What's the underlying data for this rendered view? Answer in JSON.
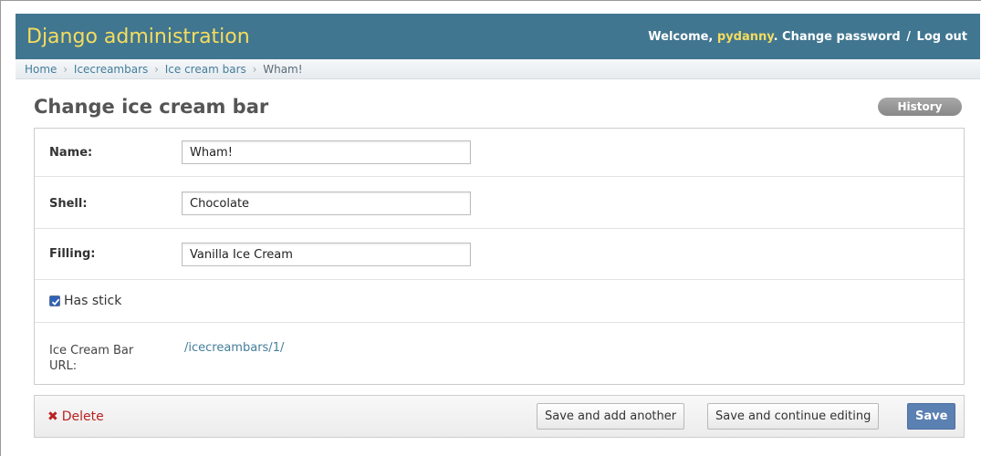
{
  "header": {
    "brand": "Django administration",
    "welcome": "Welcome,",
    "username": "pydanny",
    "change_password": "Change password",
    "separator": "/",
    "logout": "Log out"
  },
  "breadcrumbs": {
    "items": [
      "Home",
      "Icecreambars",
      "Ice cream bars",
      "Wham!"
    ],
    "separator": "›"
  },
  "page": {
    "title": "Change ice cream bar",
    "history_label": "History"
  },
  "form": {
    "name": {
      "label": "Name:",
      "value": "Wham!"
    },
    "shell": {
      "label": "Shell:",
      "value": "Chocolate"
    },
    "filling": {
      "label": "Filling:",
      "value": "Vanilla Ice Cream"
    },
    "has_stick": {
      "label": "Has stick",
      "checked": true
    },
    "url": {
      "label_line1": "Ice Cream Bar",
      "label_line2": "URL:",
      "value": "/icecreambars/1/"
    }
  },
  "submit": {
    "delete_icon": "✖",
    "delete_label": "Delete",
    "save_add_another": "Save and add another",
    "save_continue": "Save and continue editing",
    "save": "Save"
  },
  "colors": {
    "header_bg": "#417690",
    "brand": "#f5dd5d",
    "link": "#447e9b",
    "delete": "#ba2121",
    "save_button": "#5b80b2"
  }
}
